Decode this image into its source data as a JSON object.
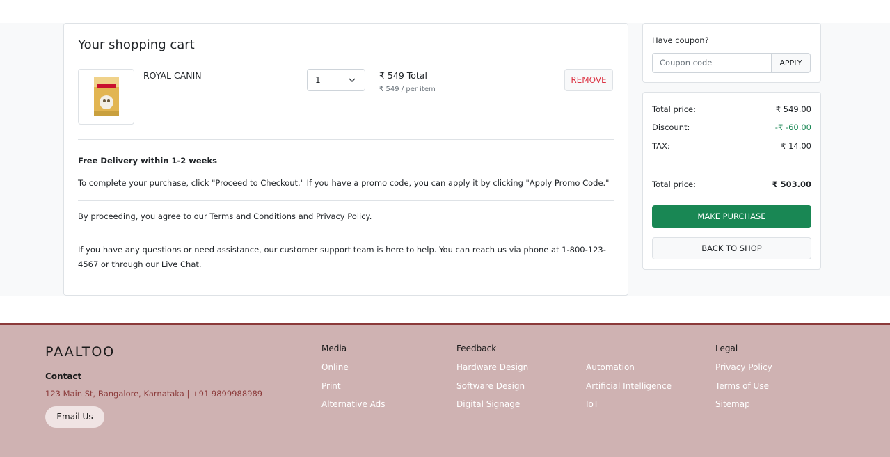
{
  "cart": {
    "title": "Your shopping cart",
    "item": {
      "name": "ROYAL CANIN",
      "image_alt": "ROYAL CANIN",
      "quantity": "1",
      "total": "₹ 549 Total",
      "per_item": "₹ 549 / per item",
      "remove_label": "REMOVE"
    },
    "delivery": "Free Delivery within 1-2 weeks",
    "checkout_note": "To complete your purchase, click \"Proceed to Checkout.\" If you have a promo code, you can apply it by clicking \"Apply Promo Code.\"",
    "terms_note": "By proceeding, you agree to our Terms and Conditions and Privacy Policy.",
    "support_note": "If you have any questions or need assistance, our customer support team is here to help. You can reach us via phone at 1-800-123-4567 or through our Live Chat."
  },
  "coupon": {
    "label": "Have coupon?",
    "placeholder": "Coupon code",
    "apply_label": "APPLY"
  },
  "summary": {
    "total_price_label": "Total price:",
    "total_price_value": "₹ 549.00",
    "discount_label": "Discount:",
    "discount_value": "-₹ -60.00",
    "tax_label": "TAX:",
    "tax_value": "₹ 14.00",
    "final_label": "Total price:",
    "final_value": "₹ 503.00",
    "purchase_label": "MAKE PURCHASE",
    "back_label": "BACK TO SHOP"
  },
  "footer": {
    "brand": "PAALTOO",
    "contact_title": "Contact",
    "contact_text": "123 Main St, Bangalore, Karnataka | +91 9899988989",
    "email_label": "Email Us",
    "media": {
      "title": "Media",
      "links": [
        "Online",
        "Print",
        "Alternative Ads"
      ]
    },
    "feedback": {
      "title": "Feedback",
      "links": [
        "Hardware Design",
        "Software Design",
        "Digital Signage"
      ]
    },
    "extra": {
      "links": [
        "Automation",
        "Artificial Intelligence",
        "IoT"
      ]
    },
    "legal": {
      "title": "Legal",
      "links": [
        "Privacy Policy",
        "Terms of Use",
        "Sitemap"
      ]
    }
  },
  "colors": {
    "accent_green": "#198754",
    "danger": "#dc3545",
    "footer_bg": "#cfb2b2",
    "footer_accent": "#8b3a3a"
  }
}
